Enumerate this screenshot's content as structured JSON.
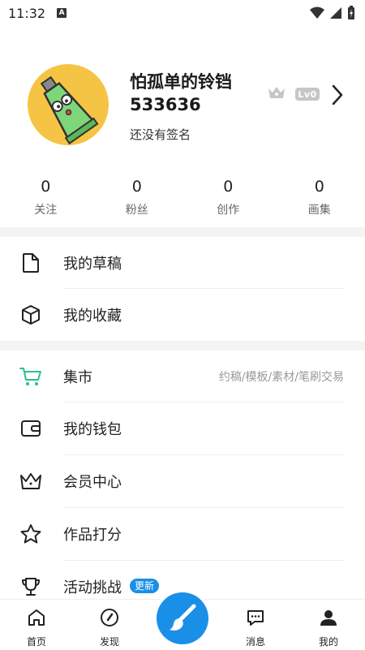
{
  "status_bar": {
    "time": "11:32",
    "notif_letter": "A"
  },
  "profile": {
    "username": "怕孤单的铃铛",
    "user_id": "533636",
    "signature": "还没有签名",
    "level": "Lv0"
  },
  "stats": [
    {
      "value": "0",
      "label": "关注"
    },
    {
      "value": "0",
      "label": "粉丝"
    },
    {
      "value": "0",
      "label": "创作"
    },
    {
      "value": "0",
      "label": "画集"
    }
  ],
  "menu_group1": [
    {
      "label": "我的草稿"
    },
    {
      "label": "我的收藏"
    }
  ],
  "menu_group2": [
    {
      "label": "集市",
      "subtitle": "约稿/模板/素材/笔刷交易"
    },
    {
      "label": "我的钱包"
    },
    {
      "label": "会员中心"
    },
    {
      "label": "作品打分"
    },
    {
      "label": "活动挑战",
      "badge": "更新"
    }
  ],
  "tabbar": [
    {
      "label": "首页"
    },
    {
      "label": "发现"
    },
    {
      "label": "消息"
    },
    {
      "label": "我的"
    }
  ],
  "colors": {
    "accent": "#1a8fe8",
    "market_green": "#2bc28a",
    "avatar_yellow": "#f6c444"
  }
}
